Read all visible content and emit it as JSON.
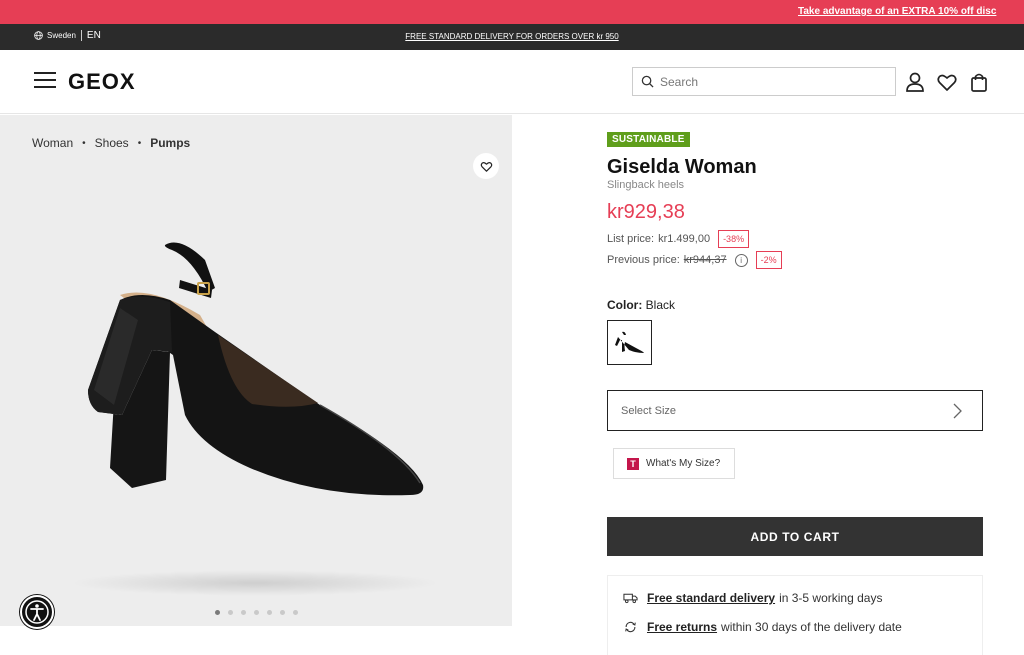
{
  "promo": {
    "text": "Take advantage of an EXTRA 10% off disc"
  },
  "utility": {
    "country": "Sweden",
    "language": "EN",
    "delivery_note": "FREE STANDARD DELIVERY FOR ORDERS OVER kr 950"
  },
  "header": {
    "logo": "GEOX",
    "search_placeholder": "Search",
    "icons": [
      "menu-icon",
      "search-icon",
      "user-icon",
      "heart-icon",
      "bag-icon"
    ]
  },
  "breadcrumb": [
    "Woman",
    "Shoes",
    "Pumps"
  ],
  "gallery": {
    "image_count": 7,
    "active_index": 0
  },
  "product": {
    "badge": "SUSTAINABLE",
    "name": "Giselda Woman",
    "subtitle": "Slingback heels",
    "price": "kr929,38",
    "list_price_label": "List price:",
    "list_price": "kr1.499,00",
    "list_discount": "-38%",
    "previous_price_label": "Previous price:",
    "previous_price": "kr944,37",
    "previous_discount": "-2%",
    "color_label": "Color:",
    "color_value": "Black",
    "size_placeholder": "Select Size",
    "whats_my_size": "What's My Size?",
    "whats_my_size_logo": "T",
    "add_to_cart": "ADD TO CART"
  },
  "benefits": [
    {
      "link": "Free standard delivery",
      "text": "in 3-5 working days",
      "icon": "truck-icon"
    },
    {
      "link": "Free returns",
      "text": "within 30 days of the delivery date",
      "icon": "return-icon"
    }
  ],
  "colors": {
    "accent": "#e63e55",
    "badge": "#5f9e1b",
    "dark": "#333333",
    "utility_bar": "#2b2b2b"
  }
}
